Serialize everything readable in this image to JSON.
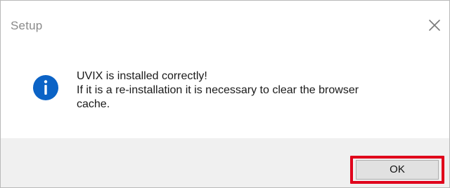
{
  "window": {
    "title": "Setup"
  },
  "icons": {
    "close": "close-icon",
    "info": "info-icon"
  },
  "message": {
    "line1": "UVIX is installed correctly!",
    "line2": "If it is a re-installation it is necessary to clear the browser\ncache."
  },
  "buttons": {
    "ok_label": "OK"
  },
  "colors": {
    "accent_info": "#0b63c6",
    "highlight": "#e0001b",
    "footer_bg": "#f0f0f0"
  }
}
